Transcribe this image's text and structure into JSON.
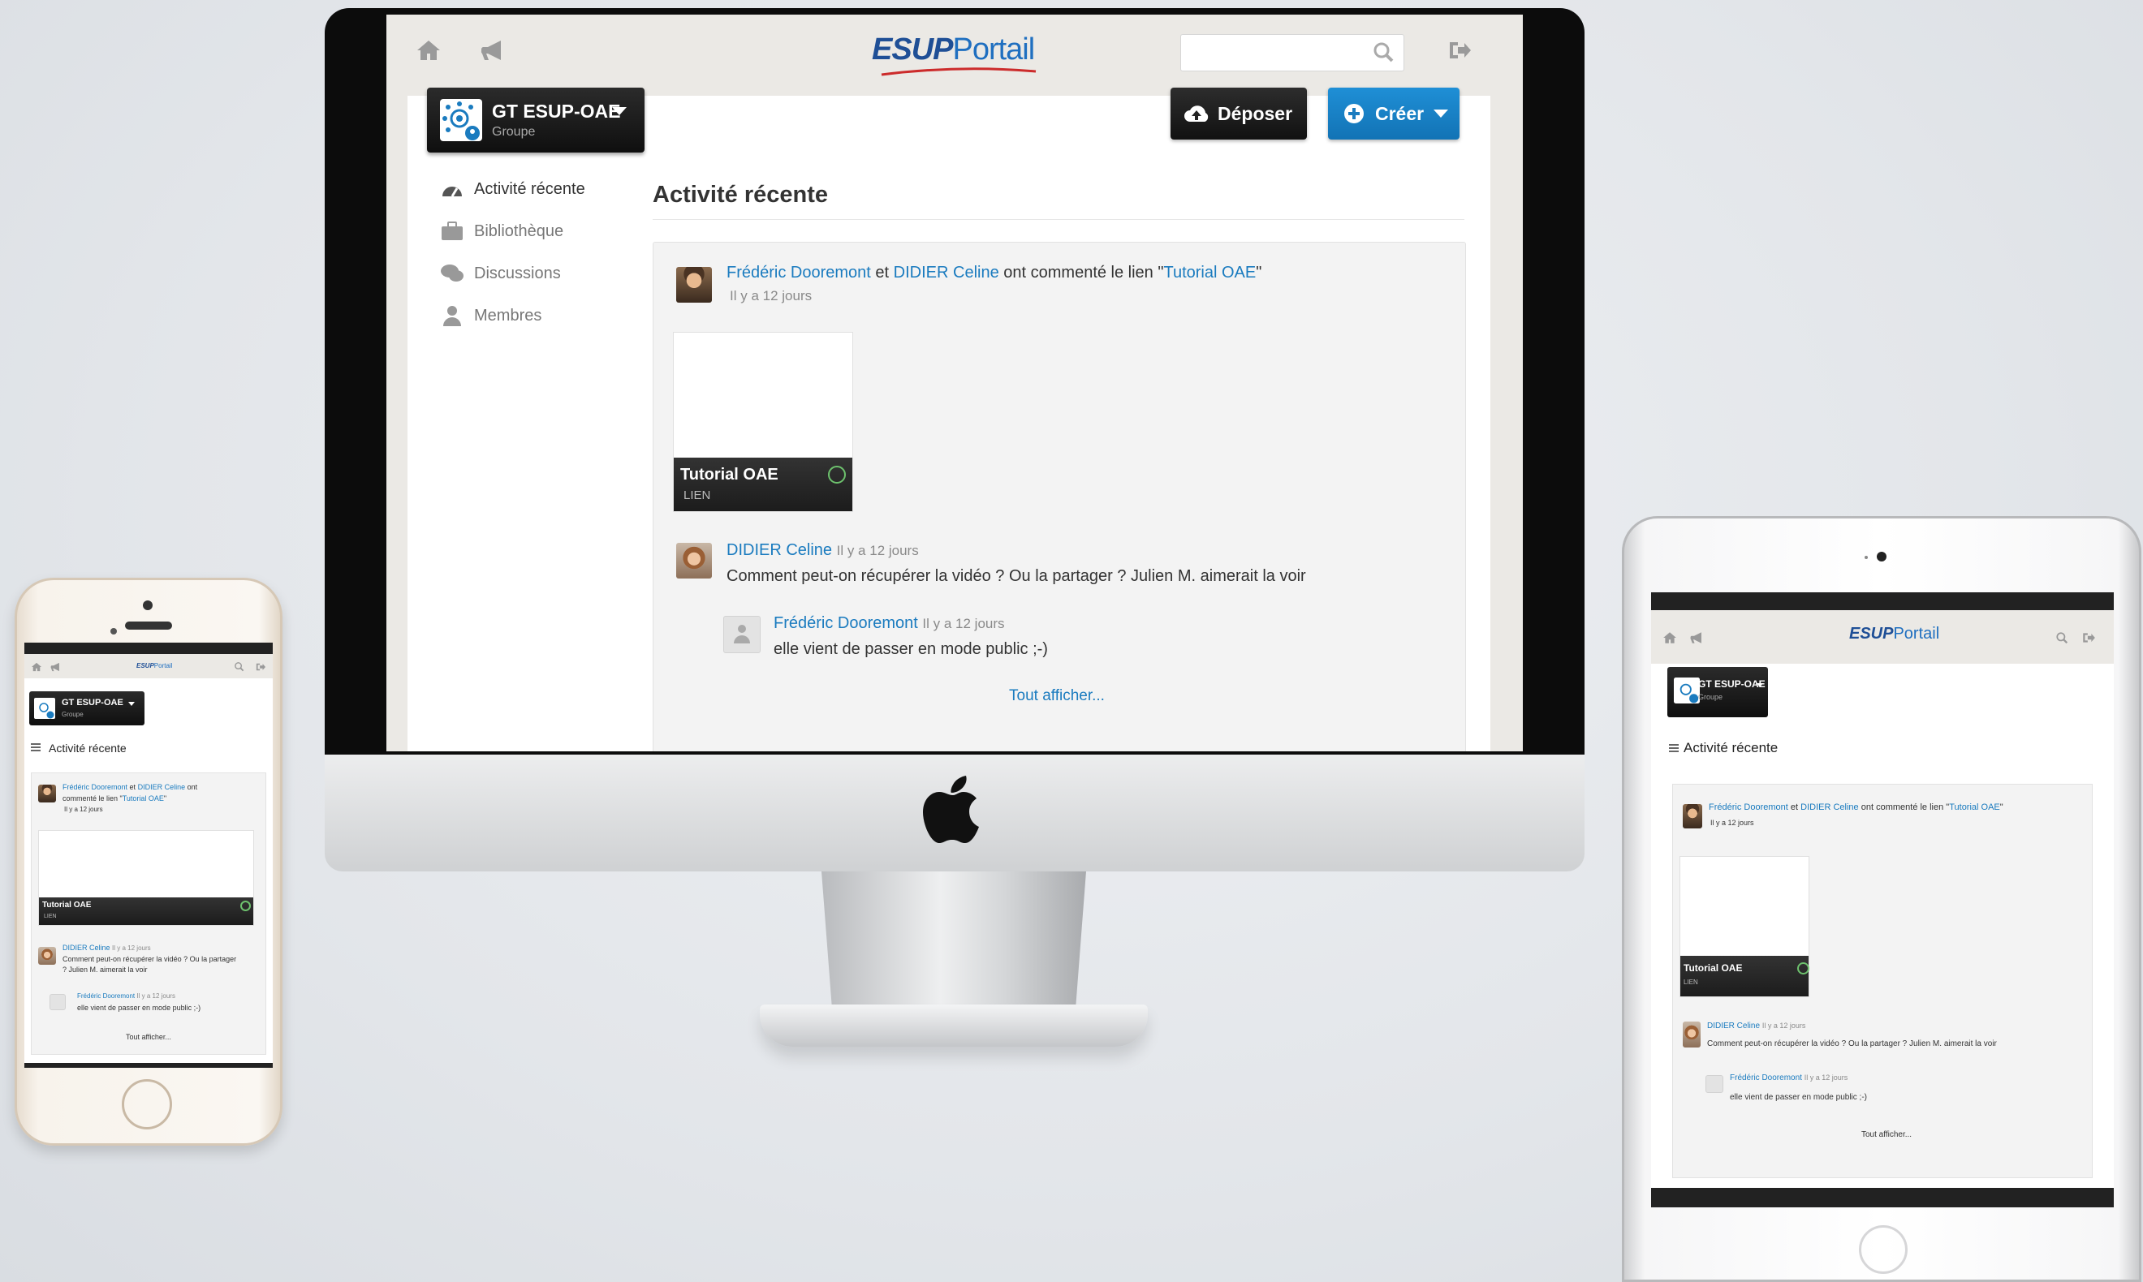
{
  "app": {
    "logo_esup": "ESUP",
    "logo_portail": "Portail"
  },
  "header": {
    "search_placeholder": "",
    "icons": [
      "home-icon",
      "megaphone-icon",
      "search-icon",
      "logout-icon"
    ]
  },
  "group": {
    "name": "GT ESUP-OAE",
    "type": "Groupe"
  },
  "actions": {
    "deposer": "Déposer",
    "creer": "Créer"
  },
  "sidebar": {
    "items": [
      {
        "label": "Activité récente",
        "icon": "dashboard-icon",
        "active": true
      },
      {
        "label": "Bibliothèque",
        "icon": "briefcase-icon",
        "active": false
      },
      {
        "label": "Discussions",
        "icon": "comments-icon",
        "active": false
      },
      {
        "label": "Membres",
        "icon": "user-icon",
        "active": false
      }
    ]
  },
  "main": {
    "title": "Activité récente",
    "activity": {
      "actor1": "Frédéric Dooremont",
      "conj": "et",
      "actor2": "DIDIER Celine",
      "verb": "ont commenté le lien \"",
      "target": "Tutorial OAE",
      "quote_end": "\"",
      "verb_mobile_1": "ont",
      "verb_mobile_2": "commenté le lien \"",
      "time": "Il y a 12 jours",
      "thumbnail": {
        "title": "Tutorial OAE",
        "subtitle": "LIEN"
      },
      "comments": [
        {
          "author": "DIDIER Celine",
          "time": "Il y a 12 jours",
          "text": "Comment peut-on récupérer la vidéo ? Ou la partager ? Julien M. aimerait la voir",
          "text_mobile_1": "Comment peut-on récupérer la vidéo ? Ou la partager",
          "text_mobile_2": "? Julien M. aimerait la voir"
        },
        {
          "author": "Frédéric Dooremont",
          "time": "Il y a 12 jours",
          "text": "elle vient de passer en mode public ;-)"
        }
      ],
      "show_all": "Tout afficher..."
    }
  },
  "colors": {
    "link": "#1a7bbf",
    "primary_button": "#1a85c9",
    "dark_button": "#1a1a1a",
    "page_bg": "#ebe9e5"
  }
}
